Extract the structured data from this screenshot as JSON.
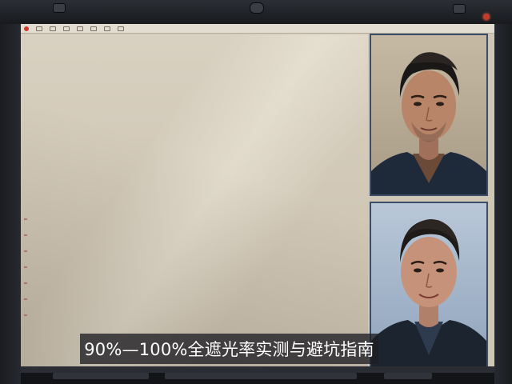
{
  "toolbar": {
    "items": [
      {
        "label": "",
        "icon": "record-dot-icon"
      },
      {
        "label": "",
        "icon": "edit-icon"
      },
      {
        "label": "",
        "icon": "link-icon"
      },
      {
        "label": "",
        "icon": "file-icon"
      },
      {
        "label": "",
        "icon": "layers-icon"
      },
      {
        "label": "",
        "icon": "frame-icon"
      },
      {
        "label": "",
        "icon": "settings-icon"
      },
      {
        "label": "",
        "icon": "view-icon"
      }
    ]
  },
  "caption": {
    "text": "90%—100%全遮光率实测与避坑指南"
  },
  "colors": {
    "accent_red": "#d0392b",
    "panel_border": "#3a4c66",
    "canvas": "#cfc6b6",
    "caption_bg": "#1e1e22"
  },
  "panels": [
    {
      "icon": "portrait-photo-icon",
      "background": "warm-beige"
    },
    {
      "icon": "portrait-photo-icon",
      "background": "cool-blue"
    }
  ]
}
